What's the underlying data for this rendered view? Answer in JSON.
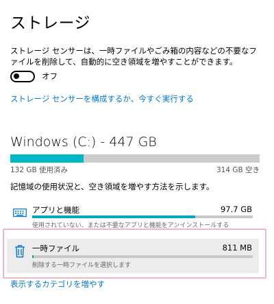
{
  "page": {
    "title": "ストレージ"
  },
  "storage_sense": {
    "description": "ストレージ センサーは、一時ファイルやごみ箱の内容などの不要なファイルを削除して、自動的に空き領域を増やすことができます。",
    "toggle_state": "オフ",
    "toggle_on": false,
    "configure_link": "ストレージ センサーを構成するか、今すぐ実行する"
  },
  "drive": {
    "title": "Windows (C:) - 447 GB",
    "used_label": "132 GB 使用済み",
    "free_label": "314 GB 空き",
    "used_fraction": 0.295,
    "usage_description": "記憶域の使用状況と、空き領域を増やす方法を示します。"
  },
  "categories": [
    {
      "name": "アプリと機能",
      "size": "97.7 GB",
      "description": "使用されていない、または不要なアプリと機能をアンインストールする",
      "fill_fraction": 0.74,
      "icon": "keyboard-icon"
    },
    {
      "name": "一時ファイル",
      "size": "811 MB",
      "description": "削除する一時ファイルを選択します",
      "fill_fraction": 0.006,
      "icon": "trash-icon"
    }
  ],
  "more_link": "表示するカテゴリを増やす",
  "colors": {
    "accent": "#0078d7",
    "usage_fill": "#00b7c3",
    "highlight_border": "#f0b6cc"
  }
}
